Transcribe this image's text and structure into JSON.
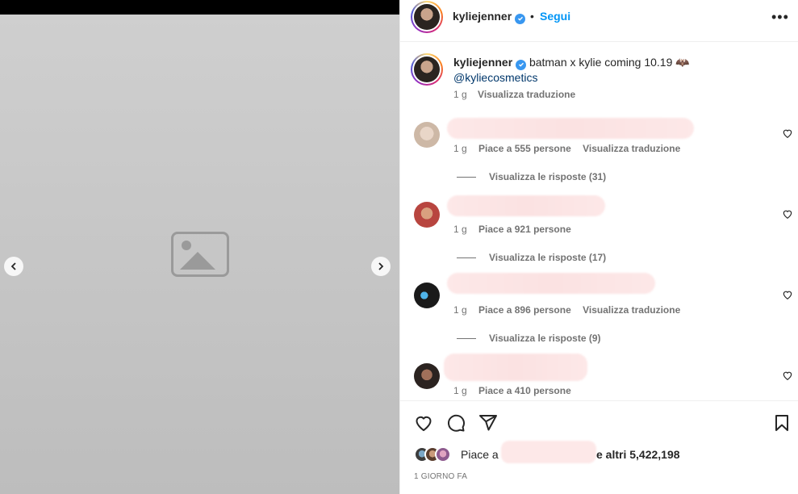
{
  "post": {
    "media_placeholder_label": "",
    "has_prev": true,
    "has_next": true
  },
  "header": {
    "username": "kyliejenner",
    "separator": "•",
    "follow_label": "Segui",
    "more_label": "•••"
  },
  "caption": {
    "username": "kyliejenner",
    "text": "batman x kylie coming 10.19 🦇",
    "mention": "@kyliecosmetics",
    "time": "1 g",
    "translate_label": "Visualizza traduzione"
  },
  "comments": [
    {
      "time": "1 g",
      "likes": "Piace a 555 persone",
      "translate_label": "Visualizza traduzione",
      "replies": "Visualizza le risposte (31)"
    },
    {
      "time": "1 g",
      "likes": "Piace a 921 persone",
      "translate_label": "",
      "replies": "Visualizza le risposte (17)"
    },
    {
      "time": "1 g",
      "likes": "Piace a 896 persone",
      "translate_label": "Visualizza traduzione",
      "replies": "Visualizza le risposte (9)"
    },
    {
      "time": "1 g",
      "likes": "Piace a 410 persone",
      "translate_label": "",
      "replies": ""
    }
  ],
  "actions": {
    "likes_prefix": "Piace a",
    "likes_suffix": "e altri 5,422,198",
    "time_ago": "1 GIORNO FA"
  },
  "colors": {
    "accent": "#0095f6",
    "verified": "#3897f0",
    "muted": "#737373",
    "mention": "#00376b"
  }
}
